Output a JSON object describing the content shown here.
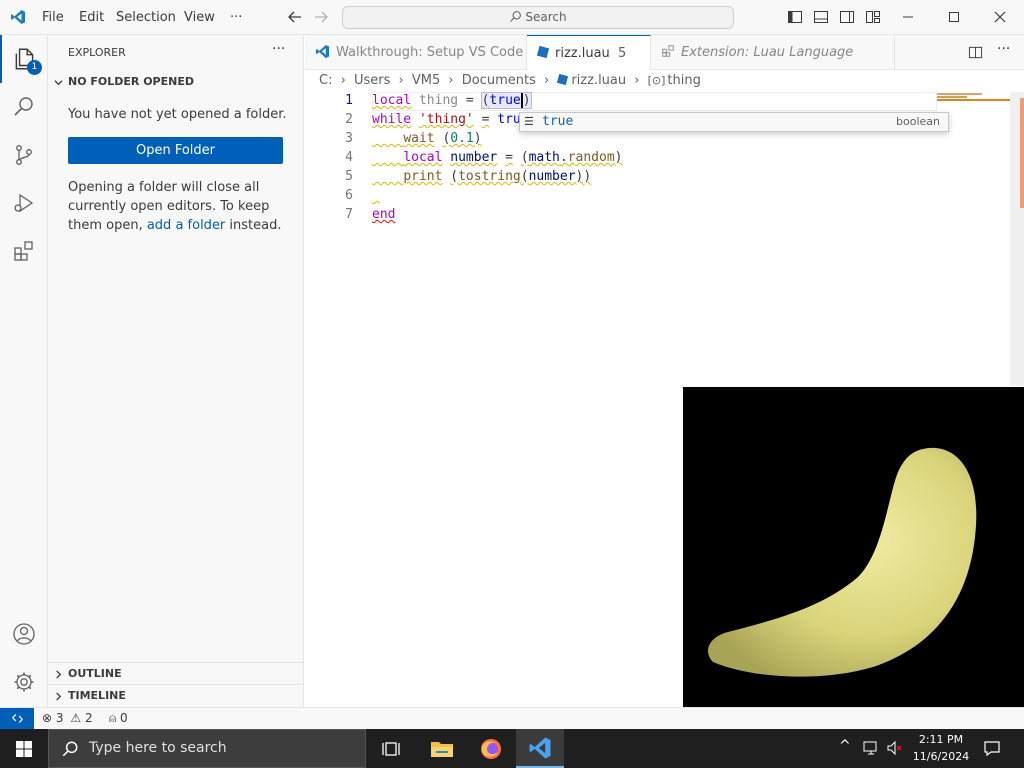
{
  "menu": {
    "file": "File",
    "edit": "Edit",
    "selection": "Selection",
    "view": "View",
    "more": "···",
    "search": "Search"
  },
  "activity": {
    "explorer_badge": "1"
  },
  "sidebar": {
    "title": "EXPLORER",
    "more": "···",
    "section_title": "NO FOLDER OPENED",
    "message": "You have not yet opened a folder.",
    "open_folder": "Open Folder",
    "info_prefix": "Opening a folder will close all currently open editors. To keep them open, ",
    "info_link": "add a folder",
    "info_suffix": " instead.",
    "outline": "OUTLINE",
    "timeline": "TIMELINE"
  },
  "tabs": [
    {
      "label": "Walkthrough: Setup VS Code"
    },
    {
      "label": "rizz.luau",
      "badge": "5",
      "modified": "●"
    },
    {
      "label": "Extension: Luau Language Server"
    }
  ],
  "breadcrumb": [
    "C:",
    "Users",
    "VM5",
    "Documents",
    "rizz.luau",
    "thing"
  ],
  "editor": {
    "line_numbers": [
      "1",
      "2",
      "3",
      "4",
      "5",
      "6",
      "7"
    ],
    "suggestion": {
      "label": "true",
      "detail": "boolean"
    }
  },
  "status": {
    "errors": "3",
    "warnings": "2",
    "ports": "0"
  },
  "taskbar": {
    "search_placeholder": "Type here to search",
    "time": "2:11 PM",
    "date": "11/6/2024"
  },
  "colors": {
    "accent": "#005fb8",
    "taskbar": "#1f1f1f"
  }
}
